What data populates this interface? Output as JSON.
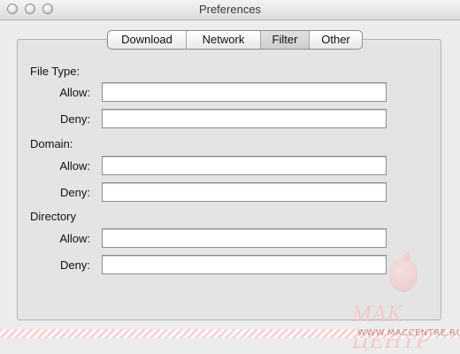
{
  "window": {
    "title": "Preferences"
  },
  "tabs": [
    {
      "label": "Download"
    },
    {
      "label": "Network"
    },
    {
      "label": "Filter",
      "selected": true
    },
    {
      "label": "Other"
    }
  ],
  "filter": {
    "file_type": {
      "heading": "File Type:",
      "allow_label": "Allow:",
      "allow_value": "",
      "deny_label": "Deny:",
      "deny_value": ""
    },
    "domain": {
      "heading": "Domain:",
      "allow_label": "Allow:",
      "allow_value": "",
      "deny_label": "Deny:",
      "deny_value": ""
    },
    "directory": {
      "heading": "Directory",
      "allow_label": "Allow:",
      "allow_value": "",
      "deny_label": "Deny:",
      "deny_value": ""
    }
  },
  "watermark": {
    "brand": "МАК ЦЕНТР",
    "url": "WWW.MACCENTRE.RU"
  },
  "colors": {
    "window_bg": "#ececec",
    "panel_bg": "#e4e4e4",
    "watermark": "#f3c9c9"
  }
}
